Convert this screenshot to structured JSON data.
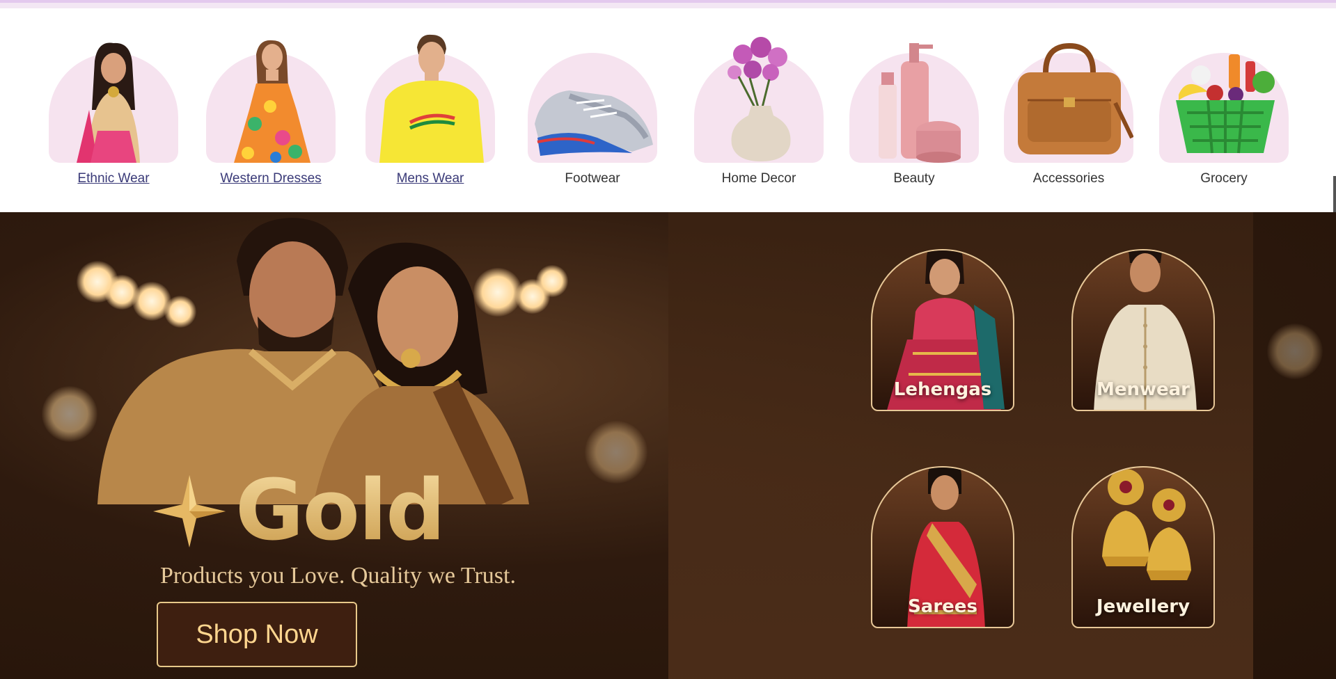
{
  "categories": [
    {
      "label": "Ethnic Wear",
      "icon": "ethnic-wear-model-image",
      "link": true
    },
    {
      "label": "Western Dresses",
      "icon": "western-dress-model-image",
      "link": true
    },
    {
      "label": "Mens Wear",
      "icon": "mens-tshirt-model-image",
      "link": true
    },
    {
      "label": "Footwear",
      "icon": "sneaker-image",
      "link": false
    },
    {
      "label": "Home Decor",
      "icon": "flower-vase-image",
      "link": false
    },
    {
      "label": "Beauty",
      "icon": "cosmetic-bottles-image",
      "link": false
    },
    {
      "label": "Accessories",
      "icon": "leather-bag-image",
      "link": false
    },
    {
      "label": "Grocery",
      "icon": "grocery-basket-image",
      "link": false
    }
  ],
  "banner": {
    "brand": "Gold",
    "tagline": "Products you Love. Quality we Trust.",
    "cta": "Shop Now",
    "tiles": [
      {
        "label": "Lehengas"
      },
      {
        "label": "Menwear"
      },
      {
        "label": "Sarees"
      },
      {
        "label": "Jewellery"
      }
    ]
  },
  "colors": {
    "arch_bg": "#f6e3ef",
    "banner_bg": "#3a2212",
    "gold": "#e6c27a",
    "cta_text": "#ffd68f"
  }
}
